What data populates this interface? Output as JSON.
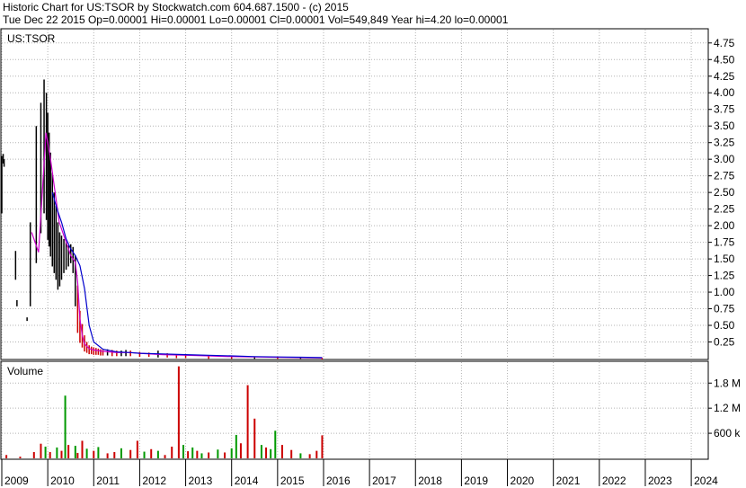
{
  "header": {
    "line1": "Historic Chart for US:TSOR by Stockwatch.com 604.687.1500 - (c) 2015",
    "line2": "Tue Dec 22 2015   Op=0.00001   Hi=0.00001   Lo=0.00001   Cl=0.00001   Vol=549,849   Year hi=4.20   lo=0.00001"
  },
  "colors": {
    "background": "#ffffff",
    "grid": "#b4b4b4",
    "price_bars": "#000000",
    "price_down": "#cc0000",
    "ma_short": "#cc00cc",
    "ma_long": "#0000cc",
    "volume_up": "#009900",
    "volume_down": "#cc0000"
  },
  "chart_data": [
    {
      "type": "line",
      "title": "US:TSOR",
      "ylim": [
        0,
        4.95
      ],
      "y_ticks": [
        "4.75",
        "4.50",
        "4.25",
        "4.00",
        "3.75",
        "3.50",
        "3.25",
        "3.00",
        "2.75",
        "2.50",
        "2.25",
        "2.00",
        "1.75",
        "1.50",
        "1.25",
        "1.00",
        "0.75",
        "0.50",
        "0.25"
      ],
      "y_tick_values": [
        4.75,
        4.5,
        4.25,
        4.0,
        3.75,
        3.5,
        3.25,
        3.0,
        2.75,
        2.5,
        2.25,
        2.0,
        1.75,
        1.5,
        1.25,
        1.0,
        0.75,
        0.5,
        0.25
      ],
      "xlim": [
        2009.0,
        2024.35
      ],
      "x_ticks": [
        "2009",
        "2010",
        "2011",
        "2012",
        "2013",
        "2014",
        "2015",
        "2016",
        "2017",
        "2018",
        "2019",
        "2020",
        "2021",
        "2022",
        "2023",
        "2024"
      ],
      "x_tick_values": [
        2009,
        2010,
        2011,
        2012,
        2013,
        2014,
        2015,
        2016,
        2017,
        2018,
        2019,
        2020,
        2021,
        2022,
        2023,
        2024
      ],
      "grid": true,
      "series": [
        {
          "kind": "price",
          "x": [
            2009.0,
            2009.03,
            2009.05,
            2009.3,
            2009.33,
            2009.55,
            2009.62,
            2009.75,
            2009.85,
            2009.92,
            2009.97,
            2010.0,
            2010.03,
            2010.06,
            2010.1,
            2010.14,
            2010.18,
            2010.22,
            2010.26,
            2010.3,
            2010.35,
            2010.4,
            2010.45,
            2010.5,
            2010.55,
            2010.6,
            2010.65,
            2010.7,
            2010.75,
            2010.8,
            2010.85,
            2010.9,
            2010.95,
            2011.0,
            2011.05,
            2011.1,
            2011.15,
            2011.2,
            2011.3,
            2011.4,
            2011.5,
            2011.6,
            2011.7,
            2011.8,
            2012.0,
            2012.2,
            2012.4,
            2012.6,
            2012.8,
            2013.0,
            2013.5,
            2014.0,
            2014.5,
            2015.0,
            2015.5,
            2015.97
          ],
          "high": [
            3.05,
            3.08,
            3.0,
            1.62,
            0.88,
            0.62,
            2.05,
            3.5,
            3.85,
            4.2,
            4.0,
            3.7,
            3.4,
            3.1,
            2.8,
            2.5,
            2.3,
            2.05,
            1.9,
            1.85,
            1.8,
            1.75,
            1.7,
            1.72,
            1.68,
            1.55,
            1.1,
            0.72,
            0.52,
            0.35,
            0.25,
            0.2,
            0.18,
            0.17,
            0.16,
            0.15,
            0.14,
            0.13,
            0.14,
            0.13,
            0.12,
            0.12,
            0.13,
            0.12,
            0.1,
            0.09,
            0.12,
            0.08,
            0.06,
            0.05,
            0.04,
            0.03,
            0.03,
            0.02,
            0.02,
            0.01
          ],
          "low": [
            2.2,
            2.95,
            2.9,
            1.2,
            0.8,
            0.58,
            0.8,
            1.45,
            1.9,
            2.2,
            2.1,
            1.8,
            1.7,
            1.55,
            1.4,
            1.3,
            1.2,
            1.05,
            1.1,
            1.2,
            1.3,
            1.35,
            1.4,
            1.45,
            1.3,
            0.8,
            0.4,
            0.25,
            0.18,
            0.12,
            0.1,
            0.08,
            0.08,
            0.07,
            0.07,
            0.07,
            0.06,
            0.06,
            0.06,
            0.05,
            0.05,
            0.05,
            0.05,
            0.05,
            0.04,
            0.04,
            0.03,
            0.03,
            0.02,
            0.02,
            0.01,
            0.01,
            0.01,
            0.01,
            0.01,
            1e-05
          ]
        },
        {
          "kind": "ma",
          "role": "short",
          "x": [
            2009.65,
            2009.8,
            2009.9,
            2009.96,
            2010.0,
            2010.05,
            2010.1,
            2010.15,
            2010.2,
            2010.25,
            2010.3,
            2010.4,
            2010.5,
            2010.6,
            2010.65,
            2010.7,
            2010.75,
            2010.8,
            2010.9,
            2011.0,
            2011.2,
            2011.5,
            2011.8,
            2012.0,
            2012.5,
            2013.0,
            2013.5,
            2014.0,
            2014.5,
            2015.0,
            2015.5,
            2015.97
          ],
          "y": [
            1.9,
            1.6,
            2.7,
            3.4,
            3.25,
            3.05,
            2.8,
            2.55,
            2.3,
            2.05,
            1.95,
            1.75,
            1.55,
            1.45,
            1.15,
            0.6,
            0.35,
            0.22,
            0.15,
            0.13,
            0.11,
            0.09,
            0.09,
            0.08,
            0.06,
            0.05,
            0.04,
            0.03,
            0.025,
            0.02,
            0.015,
            0.01
          ]
        },
        {
          "kind": "ma",
          "role": "long",
          "x": [
            2010.1,
            2010.2,
            2010.3,
            2010.4,
            2010.5,
            2010.6,
            2010.7,
            2010.8,
            2010.9,
            2011.0,
            2011.2,
            2011.5,
            2011.8,
            2012.0,
            2012.5,
            2013.0,
            2013.5,
            2014.0,
            2014.5,
            2015.0,
            2015.5,
            2015.97
          ],
          "y": [
            2.5,
            2.25,
            2.05,
            1.8,
            1.65,
            1.55,
            1.4,
            1.05,
            0.5,
            0.25,
            0.14,
            0.1,
            0.09,
            0.08,
            0.07,
            0.06,
            0.05,
            0.04,
            0.03,
            0.025,
            0.02,
            0.015
          ]
        }
      ]
    },
    {
      "type": "bar",
      "title": "Volume",
      "ylim": [
        0,
        2300000
      ],
      "y_ticks": [
        "1.8 M",
        "1.2 M",
        "600 k"
      ],
      "y_tick_values": [
        1800000,
        1200000,
        600000
      ],
      "xlim": [
        2009.0,
        2024.35
      ],
      "x": [
        2009.1,
        2009.4,
        2009.7,
        2009.85,
        2009.95,
        2010.05,
        2010.2,
        2010.3,
        2010.38,
        2010.45,
        2010.6,
        2010.65,
        2010.75,
        2010.85,
        2011.0,
        2011.1,
        2011.3,
        2011.45,
        2011.6,
        2011.8,
        2011.95,
        2012.1,
        2012.25,
        2012.4,
        2012.55,
        2012.7,
        2012.85,
        2012.95,
        2013.05,
        2013.15,
        2013.25,
        2013.35,
        2013.5,
        2013.7,
        2013.85,
        2014.0,
        2014.1,
        2014.2,
        2014.35,
        2014.5,
        2014.65,
        2014.75,
        2014.85,
        2014.95,
        2015.1,
        2015.3,
        2015.5,
        2015.7,
        2015.85,
        2015.97
      ],
      "values": [
        80000,
        40000,
        150000,
        350000,
        280000,
        150000,
        260000,
        180000,
        1500000,
        320000,
        300000,
        130000,
        420000,
        230000,
        180000,
        270000,
        120000,
        150000,
        240000,
        200000,
        420000,
        160000,
        220000,
        180000,
        80000,
        280000,
        2200000,
        320000,
        170000,
        260000,
        180000,
        120000,
        140000,
        210000,
        140000,
        240000,
        560000,
        360000,
        1750000,
        950000,
        320000,
        260000,
        220000,
        660000,
        320000,
        200000,
        120000,
        100000,
        180000,
        550000
      ],
      "series_colors": [
        "volume_down",
        "volume_down",
        "volume_down",
        "volume_down",
        "volume_up",
        "volume_down",
        "volume_up",
        "volume_down",
        "volume_up",
        "volume_down",
        "volume_up",
        "volume_down",
        "volume_down",
        "volume_up",
        "volume_down",
        "volume_up",
        "volume_down",
        "volume_down",
        "volume_up",
        "volume_down",
        "volume_down",
        "volume_up",
        "volume_down",
        "volume_up",
        "volume_down",
        "volume_down",
        "volume_down",
        "volume_up",
        "volume_down",
        "volume_up",
        "volume_down",
        "volume_up",
        "volume_down",
        "volume_up",
        "volume_down",
        "volume_up",
        "volume_up",
        "volume_down",
        "volume_down",
        "volume_down",
        "volume_up",
        "volume_down",
        "volume_up",
        "volume_up",
        "volume_down",
        "volume_down",
        "volume_up",
        "volume_down",
        "volume_down",
        "volume_down"
      ]
    }
  ]
}
